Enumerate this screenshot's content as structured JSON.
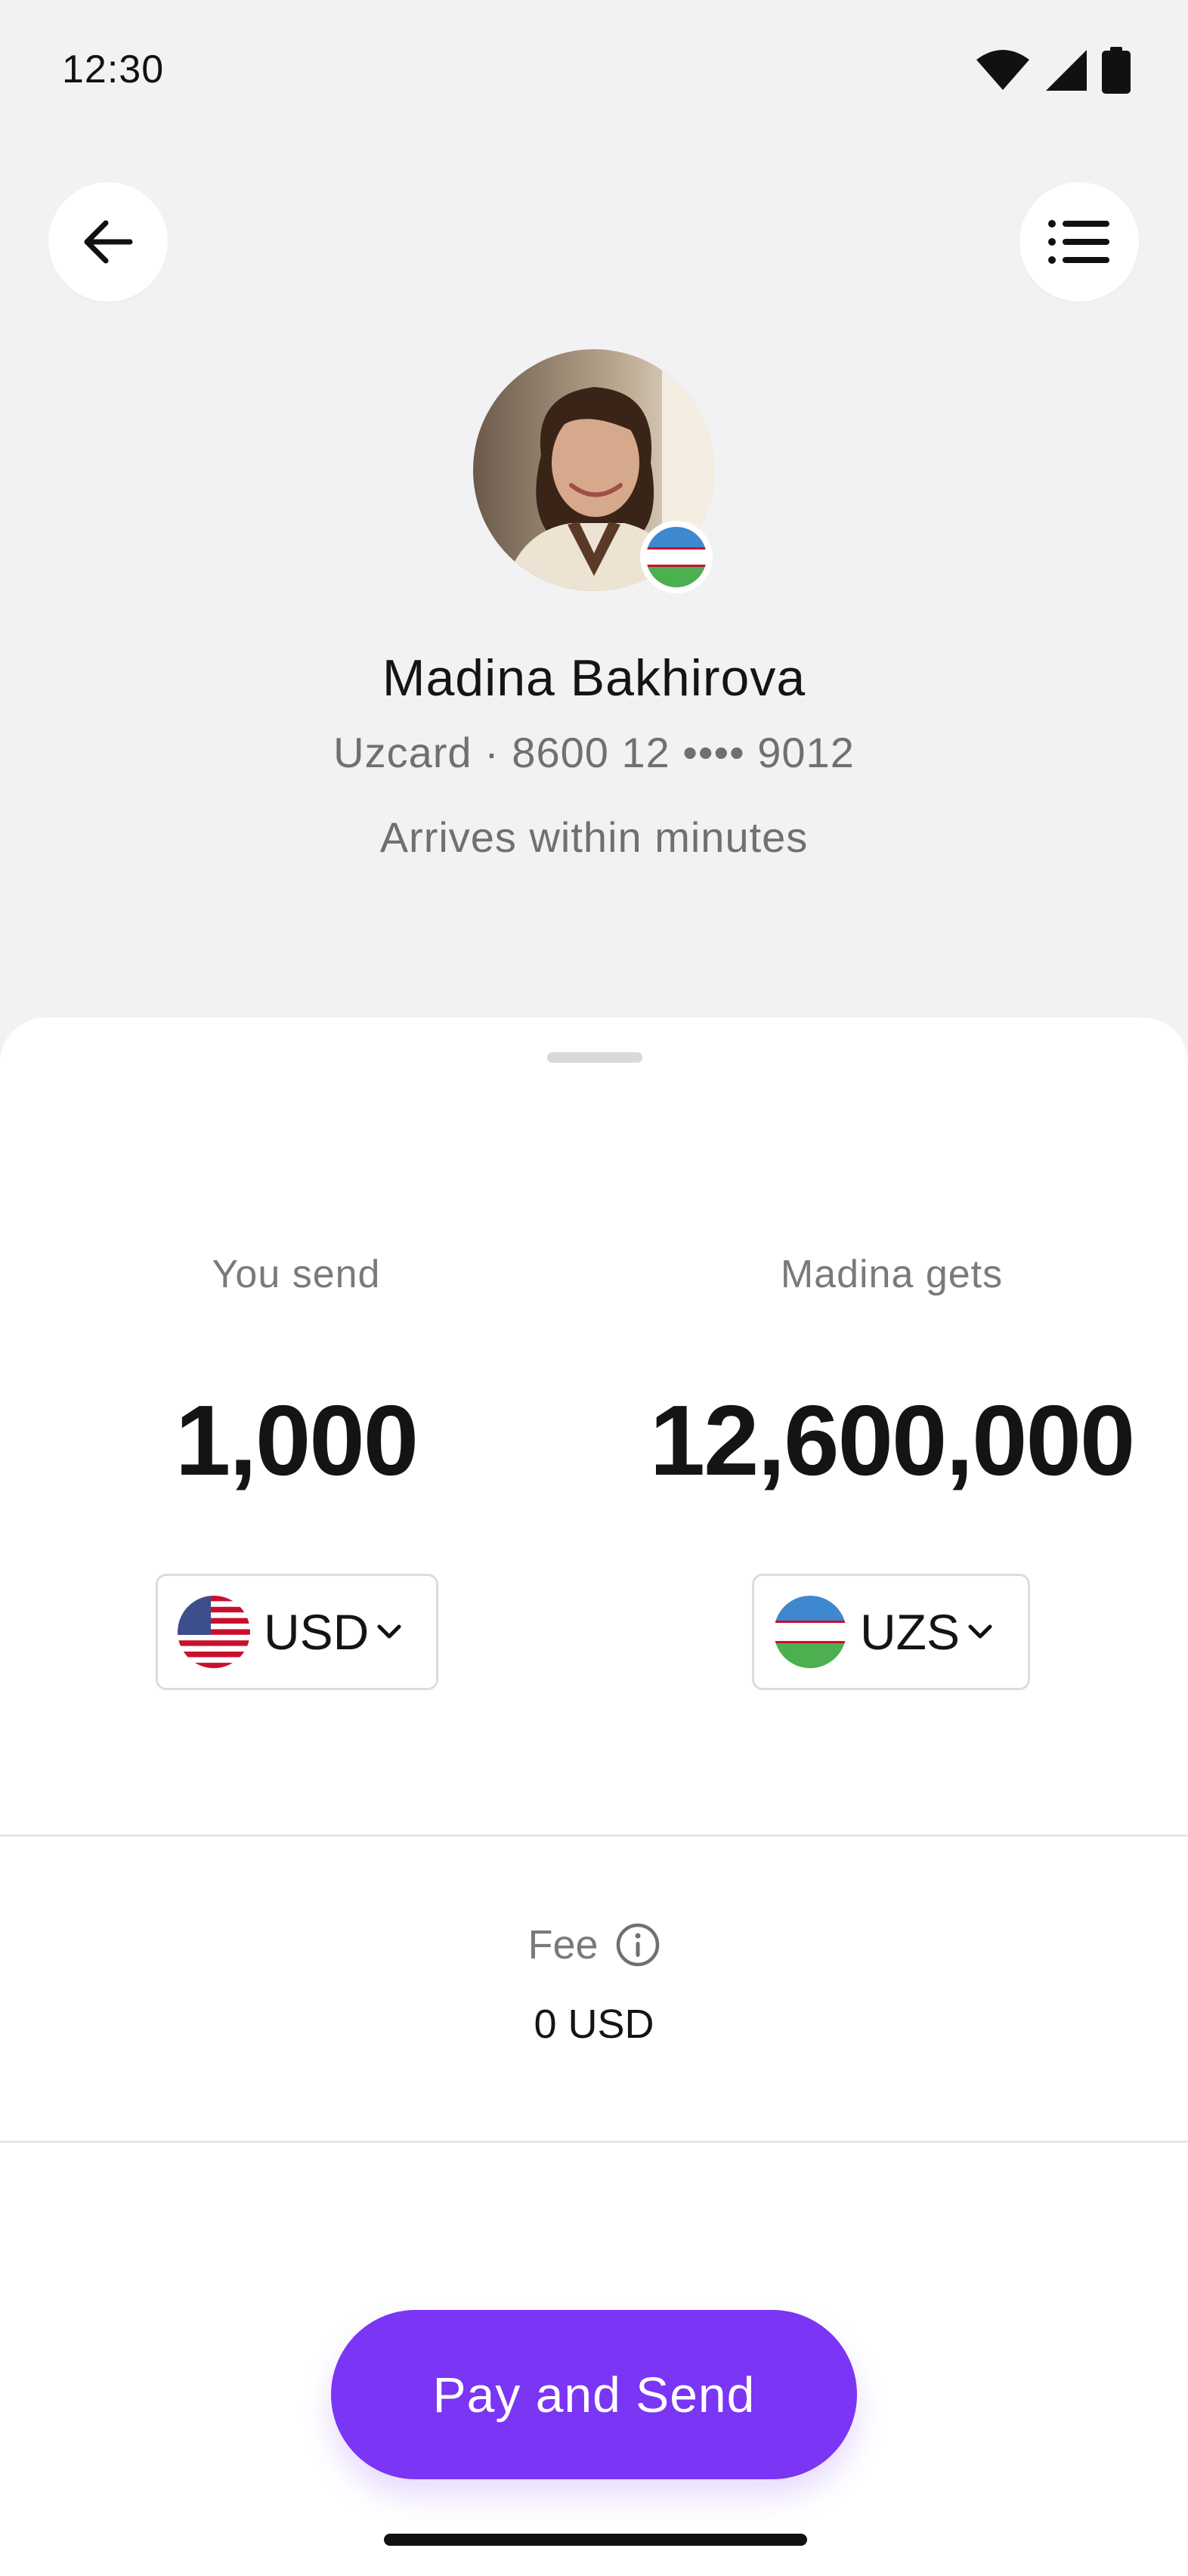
{
  "status_bar": {
    "time": "12:30",
    "icons": [
      "wifi-icon",
      "signal-icon",
      "battery-icon"
    ]
  },
  "header": {
    "back_icon": "arrow-left-icon",
    "menu_icon": "list-icon"
  },
  "recipient": {
    "name": "Madina Bakhirova",
    "card": "Uzcard · 8600 12 •••• 9012",
    "arrival": "Arrives within minutes",
    "country_flag": "uzbekistan-flag-icon"
  },
  "transfer": {
    "send_label": "You send",
    "send_amount": "1,000",
    "send_currency": "USD",
    "gets_label": "Madina gets",
    "gets_amount": "12,600,000",
    "gets_currency": "UZS"
  },
  "fee": {
    "label": "Fee",
    "value": "0 USD"
  },
  "actions": {
    "pay_label": "Pay and Send"
  },
  "colors": {
    "accent": "#7a35f5",
    "background": "#f2f2f4",
    "sheet": "#ffffff"
  }
}
